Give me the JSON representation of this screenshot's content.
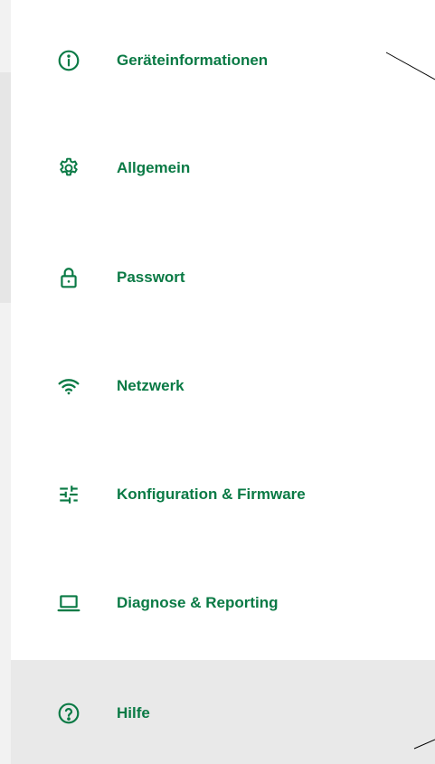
{
  "menu": {
    "accent_color": "#0a7a45",
    "items": [
      {
        "label": "Geräteinformationen",
        "icon": "info-icon"
      },
      {
        "label": "Allgemein",
        "icon": "gear-icon"
      },
      {
        "label": "Passwort",
        "icon": "lock-icon"
      },
      {
        "label": "Netzwerk",
        "icon": "wifi-icon"
      },
      {
        "label": "Konfiguration & Firmware",
        "icon": "sliders-icon"
      },
      {
        "label": "Diagnose & Reporting",
        "icon": "laptop-icon"
      },
      {
        "label": "Hilfe",
        "icon": "help-icon"
      }
    ],
    "active_index": 6
  }
}
